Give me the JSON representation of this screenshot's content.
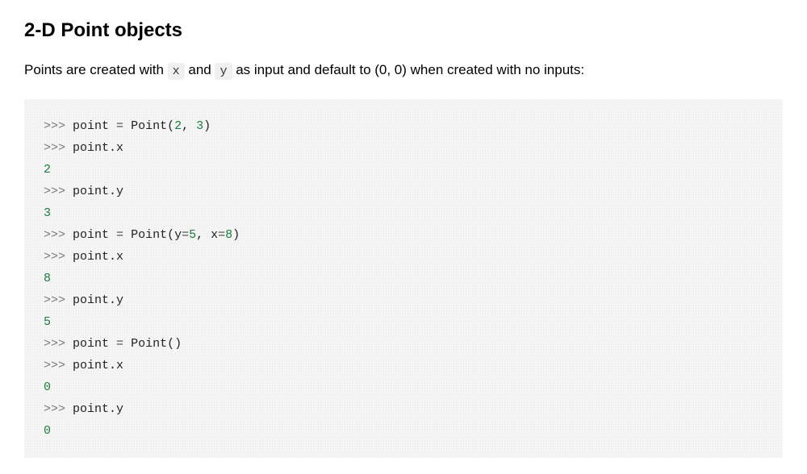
{
  "heading": "2-D Point objects",
  "intro": {
    "prefix": "Points are created with ",
    "code1": "x",
    "mid1": " and ",
    "code2": "y",
    "suffix": " as input and default to (0, 0) when created with no inputs:"
  },
  "code": {
    "prompt": ">>>",
    "l1a": "point ",
    "l1b": "=",
    "l1c": " Point(",
    "l1d": "2",
    "l1e": ", ",
    "l1f": "3",
    "l1g": ")",
    "l2": "point.x",
    "o2": "2",
    "l3": "point.y",
    "o3": "3",
    "l4a": "point ",
    "l4b": "=",
    "l4c": " Point(y",
    "l4d": "=",
    "l4e": "5",
    "l4f": ", x",
    "l4g": "=",
    "l4h": "8",
    "l4i": ")",
    "l5": "point.x",
    "o5": "8",
    "l6": "point.y",
    "o6": "5",
    "l7a": "point ",
    "l7b": "=",
    "l7c": " Point()",
    "l8": "point.x",
    "o8": "0",
    "l9": "point.y",
    "o9": "0"
  }
}
